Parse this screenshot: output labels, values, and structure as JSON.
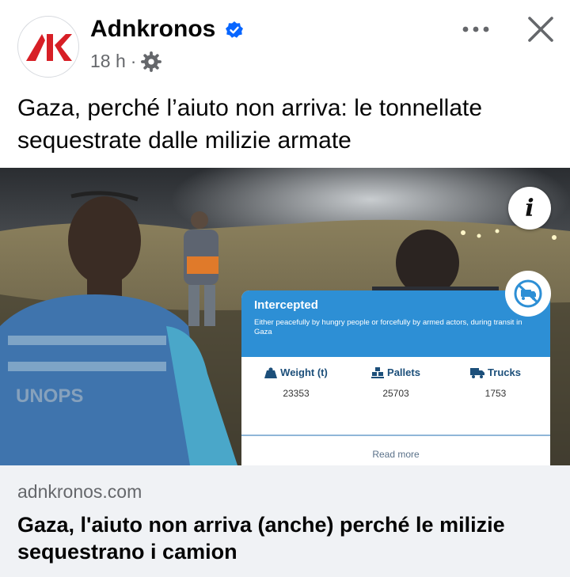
{
  "post": {
    "page_name": "Adnkronos",
    "time": "18 h",
    "separator": "·",
    "audience_icon": "gear-icon",
    "verified_icon": "verified-badge-icon",
    "more_icon": "more-dots-icon",
    "close_icon": "close-icon",
    "caption": "Gaza, perché l’aiuto non arriva: le tonnellate sequestrate dalle milizie armate"
  },
  "image": {
    "vest_text": "UNOPS",
    "info_label": "i",
    "card": {
      "title": "Intercepted",
      "description": "Either peacefully by hungry people or forcefully by armed actors, during transit in Gaza",
      "stats": [
        {
          "label": "Weight (t)",
          "value": "23353",
          "icon": "weight-icon"
        },
        {
          "label": "Pallets",
          "value": "25703",
          "icon": "pallets-icon"
        },
        {
          "label": "Trucks",
          "value": "1753",
          "icon": "truck-icon"
        }
      ],
      "read_more": "Read more"
    }
  },
  "link": {
    "domain": "adnkronos.com",
    "title": "Gaza, l'aiuto non arriva (anche) perché le milizie sequestrano i camion"
  },
  "colors": {
    "brand_red": "#d71f26",
    "verified_blue": "#0866ff",
    "card_blue": "#2d8fd5",
    "link_bg": "#f0f2f5"
  }
}
